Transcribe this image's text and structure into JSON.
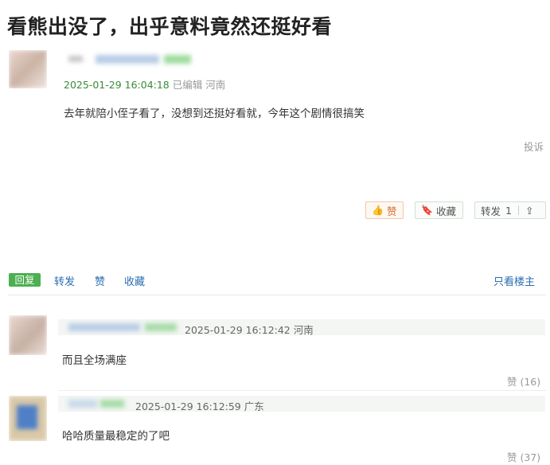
{
  "title": "看熊出没了，出乎意料竟然还挺好看",
  "post": {
    "datetime": "2025-01-29 16:04:18",
    "edited": "已编辑",
    "location": "河南",
    "content": "去年就陪小侄子看了，没想到还挺好看就，今年这个剧情很搞笑",
    "report": "投诉",
    "like_icon": "thumbs-up-icon",
    "like_label": "赞",
    "collect_label": "收藏",
    "forward_label": "转发",
    "forward_count": "1",
    "share_icon": "share-icon"
  },
  "actions": {
    "reply_label": "回复",
    "forward_label": "转发",
    "like_label": "赞",
    "collect_label": "收藏",
    "only_op_label": "只看楼主"
  },
  "comments": [
    {
      "datetime": "2025-01-29 16:12:42",
      "location": "河南",
      "content": "而且全场满座",
      "likes": "赞 (16)"
    },
    {
      "datetime": "2025-01-29 16:12:59",
      "location": "广东",
      "content": "哈哈质量最稳定的了吧",
      "likes": "赞 (37)"
    }
  ],
  "colors": {
    "accent_green": "#4caf50",
    "link_blue": "#2a6db0",
    "like_orange": "#d0702f"
  }
}
